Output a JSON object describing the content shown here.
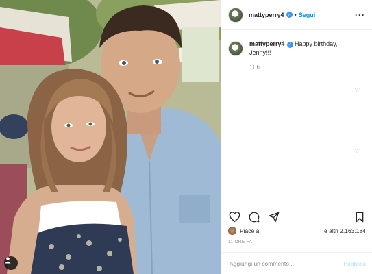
{
  "post": {
    "username": "mattyperry4",
    "verified_icon": "verified-badge-icon",
    "separator": "•",
    "follow_label": "Segui",
    "more_icon": "more-options-icon",
    "caption_text": "Happy birthday, Jenny!!!",
    "caption_time": "11 h",
    "likes_prefix": "Piace a",
    "likes_suffix": "e altri 2.163.184",
    "timestamp": "11 ORE FA",
    "comment_placeholder": "Aggiungi un commento...",
    "publish_label": "Pubblica"
  },
  "colors": {
    "link_blue": "#0095f6",
    "publish_disabled": "#b2dffc",
    "verified": "#3897f0",
    "muted": "#8e8e8e"
  },
  "icons": [
    "heart-icon",
    "comment-icon",
    "share-icon",
    "bookmark-icon",
    "user-tag-icon"
  ]
}
